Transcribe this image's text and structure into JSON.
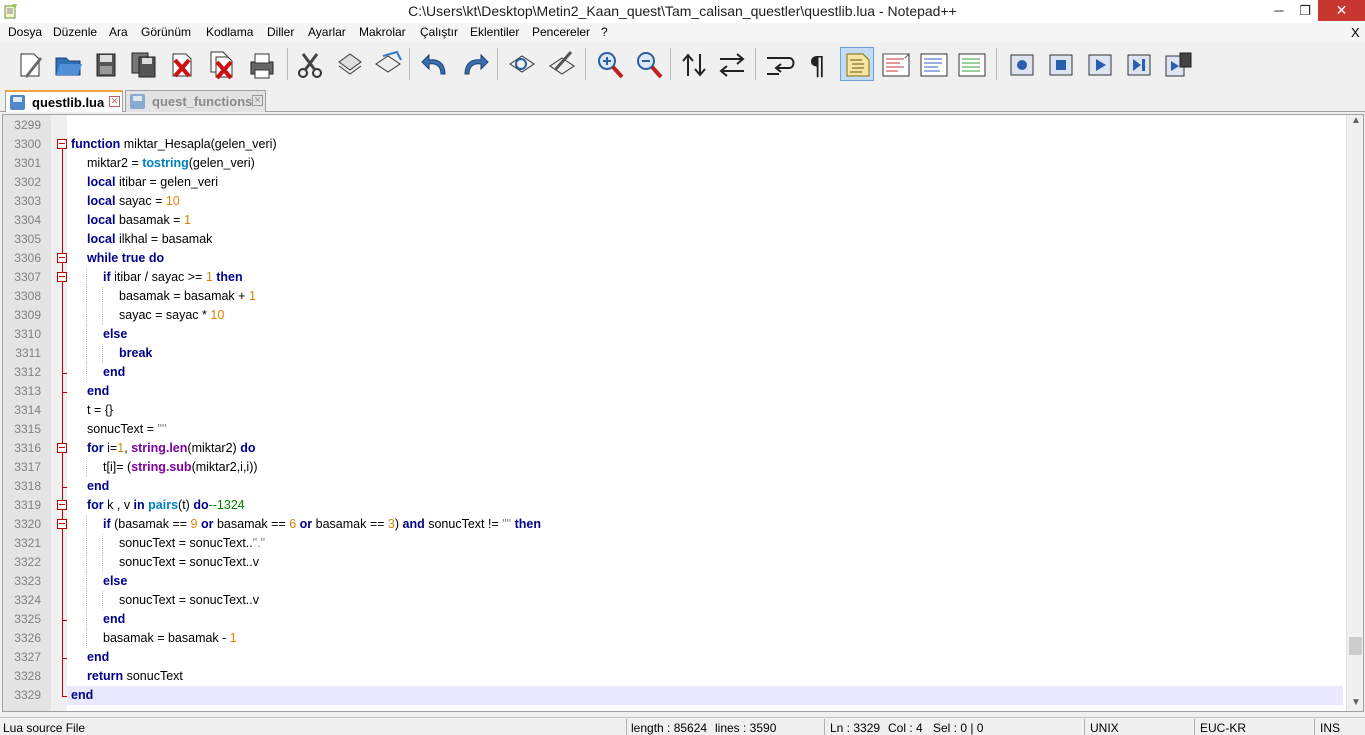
{
  "window": {
    "title": "C:\\Users\\kt\\Desktop\\Metin2_Kaan_quest\\Tam_calisan_questler\\questlib.lua - Notepad++",
    "minimize_glyph": "─",
    "maximize_glyph": "❐",
    "close_glyph": "✕"
  },
  "menu": {
    "items": [
      "Dosya",
      "Düzenle",
      "Ara",
      "Görünüm",
      "Kodlama",
      "Diller",
      "Ayarlar",
      "Makrolar",
      "Çalıştır",
      "Eklentiler",
      "Pencereler",
      "?"
    ],
    "doc_close": "X"
  },
  "toolbar": {
    "icons": [
      "new-file-icon",
      "open-file-icon",
      "save-icon",
      "save-all-icon",
      "close-icon",
      "close-all-icon",
      "print-icon",
      "cut-icon",
      "copy-icon",
      "paste-icon",
      "undo-icon",
      "redo-icon",
      "find-icon",
      "replace-icon",
      "zoom-in-icon",
      "zoom-out-icon",
      "sync-vertical-icon",
      "sync-horizontal-icon",
      "word-wrap-icon",
      "show-all-chars-icon",
      "indent-guide-icon",
      "user-lang-icon",
      "doc-map-icon",
      "function-list-icon",
      "record-macro-icon",
      "stop-macro-icon",
      "play-macro-icon",
      "run-macro-multiple-icon",
      "save-macro-icon"
    ],
    "active_icon": "indent-guide-icon"
  },
  "tabs": [
    {
      "label": "questlib.lua",
      "active": true
    },
    {
      "label": "quest_functions",
      "active": false
    }
  ],
  "editor": {
    "current_line": "3329",
    "lines": [
      {
        "n": "3299",
        "indent": 0,
        "tokens": []
      },
      {
        "n": "3300",
        "indent": 0,
        "tokens": [
          [
            "kw",
            "function"
          ],
          [
            "",
            "  miktar_Hesapla(gelen_veri)"
          ]
        ]
      },
      {
        "n": "3301",
        "indent": 1,
        "tokens": [
          [
            "",
            "miktar2 = "
          ],
          [
            "fn",
            "tostring"
          ],
          [
            "",
            "(gelen_veri)"
          ]
        ]
      },
      {
        "n": "3302",
        "indent": 1,
        "tokens": [
          [
            "kw",
            "local"
          ],
          [
            "",
            "  itibar = gelen_veri"
          ]
        ]
      },
      {
        "n": "3303",
        "indent": 1,
        "tokens": [
          [
            "kw",
            "local"
          ],
          [
            "",
            "  sayac = "
          ],
          [
            "num",
            "10"
          ]
        ]
      },
      {
        "n": "3304",
        "indent": 1,
        "tokens": [
          [
            "kw",
            "local"
          ],
          [
            "",
            "  basamak = "
          ],
          [
            "num",
            "1"
          ]
        ]
      },
      {
        "n": "3305",
        "indent": 1,
        "tokens": [
          [
            "kw",
            "local"
          ],
          [
            "",
            "  ilkhal = basamak"
          ]
        ]
      },
      {
        "n": "3306",
        "indent": 1,
        "tokens": [
          [
            "kw",
            "while true do"
          ]
        ]
      },
      {
        "n": "3307",
        "indent": 2,
        "tokens": [
          [
            "kw",
            "if"
          ],
          [
            "",
            "  itibar / sayac >= "
          ],
          [
            "num",
            "1"
          ],
          [
            "",
            ""
          ],
          [
            "kw",
            " then"
          ]
        ]
      },
      {
        "n": "3308",
        "indent": 3,
        "tokens": [
          [
            "",
            "basamak = basamak + "
          ],
          [
            "num",
            "1"
          ]
        ]
      },
      {
        "n": "3309",
        "indent": 3,
        "tokens": [
          [
            "",
            "sayac = sayac * "
          ],
          [
            "num",
            "10"
          ]
        ]
      },
      {
        "n": "3310",
        "indent": 2,
        "tokens": [
          [
            "kw",
            "else"
          ]
        ]
      },
      {
        "n": "3311",
        "indent": 3,
        "tokens": [
          [
            "kw",
            "break"
          ]
        ]
      },
      {
        "n": "3312",
        "indent": 2,
        "tokens": [
          [
            "kw",
            "end"
          ]
        ]
      },
      {
        "n": "3313",
        "indent": 1,
        "tokens": [
          [
            "kw",
            "end"
          ]
        ]
      },
      {
        "n": "3314",
        "indent": 1,
        "tokens": [
          [
            "",
            "t = {}"
          ]
        ]
      },
      {
        "n": "3315",
        "indent": 1,
        "tokens": [
          [
            "",
            "sonucText = "
          ],
          [
            "str",
            "\"\""
          ]
        ]
      },
      {
        "n": "3316",
        "indent": 1,
        "tokens": [
          [
            "kw",
            "for"
          ],
          [
            "",
            "  i="
          ],
          [
            "num",
            "1"
          ],
          [
            "",
            ", "
          ],
          [
            "lib",
            "string.len"
          ],
          [
            "",
            "(miktar2) "
          ],
          [
            "kw",
            "do"
          ]
        ]
      },
      {
        "n": "3317",
        "indent": 2,
        "tokens": [
          [
            "",
            "t[i]= ("
          ],
          [
            "lib",
            "string.sub"
          ],
          [
            "",
            "(miktar2,i,i))"
          ]
        ]
      },
      {
        "n": "3318",
        "indent": 1,
        "tokens": [
          [
            "kw",
            "end"
          ]
        ]
      },
      {
        "n": "3319",
        "indent": 1,
        "tokens": [
          [
            "kw",
            "for"
          ],
          [
            "",
            "  k , v "
          ],
          [
            "kw",
            "in"
          ],
          [
            "",
            "  "
          ],
          [
            "fn",
            "pairs"
          ],
          [
            "",
            "(t) "
          ],
          [
            "kw",
            "do"
          ],
          [
            "cmt",
            "--1324"
          ]
        ]
      },
      {
        "n": "3320",
        "indent": 2,
        "tokens": [
          [
            "kw",
            "if"
          ],
          [
            "",
            "  (basamak  == "
          ],
          [
            "num",
            "9"
          ],
          [
            "",
            "  "
          ],
          [
            "kw",
            "or"
          ],
          [
            "",
            "  basamak == "
          ],
          [
            "num",
            "6"
          ],
          [
            "",
            "  "
          ],
          [
            "kw",
            "or"
          ],
          [
            "",
            "  basamak == "
          ],
          [
            "num",
            "3"
          ],
          [
            "",
            ")  "
          ],
          [
            "kw",
            "and"
          ],
          [
            "",
            "  sonucText !=  "
          ],
          [
            "str",
            "\"\""
          ],
          [
            "",
            "  "
          ],
          [
            "kw",
            "then"
          ]
        ]
      },
      {
        "n": "3321",
        "indent": 3,
        "tokens": [
          [
            "",
            "sonucText = sonucText.."
          ],
          [
            "str",
            "\".\""
          ]
        ]
      },
      {
        "n": "3322",
        "indent": 3,
        "tokens": [
          [
            "",
            "sonucText = sonucText..v"
          ]
        ]
      },
      {
        "n": "3323",
        "indent": 2,
        "tokens": [
          [
            "kw",
            "else"
          ]
        ]
      },
      {
        "n": "3324",
        "indent": 3,
        "tokens": [
          [
            "",
            "sonucText = sonucText..v"
          ]
        ]
      },
      {
        "n": "3325",
        "indent": 2,
        "tokens": [
          [
            "kw",
            "end"
          ]
        ]
      },
      {
        "n": "3326",
        "indent": 2,
        "tokens": [
          [
            "",
            "basamak = basamak - "
          ],
          [
            "num",
            "1"
          ]
        ]
      },
      {
        "n": "3327",
        "indent": 1,
        "tokens": [
          [
            "kw",
            "end"
          ]
        ]
      },
      {
        "n": "3328",
        "indent": 1,
        "tokens": [
          [
            "kw",
            "return"
          ],
          [
            "",
            "  sonucText"
          ]
        ]
      },
      {
        "n": "3329",
        "indent": 0,
        "tokens": [
          [
            "kw",
            "end"
          ]
        ]
      }
    ]
  },
  "status": {
    "file_type": "Lua source File",
    "length": "length : 85624",
    "lines": "lines : 3590",
    "ln": "Ln : 3329",
    "col": "Col : 4",
    "sel": "Sel : 0 | 0",
    "eol": "UNIX",
    "encoding": "EUC-KR",
    "mode": "INS"
  },
  "colors": {
    "keyword": "#00008b",
    "builtin": "#0080c0",
    "library": "#8000a0",
    "number": "#e08000",
    "comment": "#008000",
    "fold": "#c00000",
    "current_line": "#e8e8ff"
  }
}
